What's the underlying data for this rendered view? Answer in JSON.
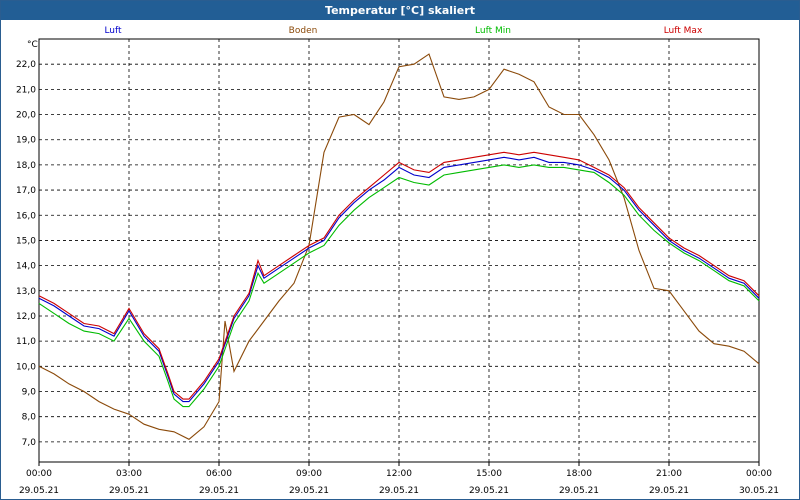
{
  "window": {
    "title": "Temperatur [°C] skaliert"
  },
  "chart_data": {
    "type": "line",
    "title": "Temperatur [°C] skaliert",
    "ylabel": "°C",
    "xlabel": "",
    "ylim": [
      6.2,
      23.0
    ],
    "xlim": [
      0,
      24
    ],
    "grid": true,
    "legend_position": "top",
    "yticks": [
      "7,0",
      "8,0",
      "9,0",
      "10,0",
      "11,0",
      "12,0",
      "13,0",
      "14,0",
      "15,0",
      "16,0",
      "17,0",
      "18,0",
      "19,0",
      "20,0",
      "21,0",
      "22,0"
    ],
    "xticks": [
      {
        "time": "00:00",
        "date": "29.05.21"
      },
      {
        "time": "03:00",
        "date": "29.05.21"
      },
      {
        "time": "06:00",
        "date": "29.05.21"
      },
      {
        "time": "09:00",
        "date": "29.05.21"
      },
      {
        "time": "12:00",
        "date": "29.05.21"
      },
      {
        "time": "15:00",
        "date": "29.05.21"
      },
      {
        "time": "18:00",
        "date": "29.05.21"
      },
      {
        "time": "21:00",
        "date": "29.05.21"
      },
      {
        "time": "00:00",
        "date": "30.05.21"
      }
    ],
    "series": [
      {
        "name": "Luft",
        "color": "#0000cc",
        "x": [
          0,
          0.5,
          1,
          1.5,
          2,
          2.5,
          3,
          3.5,
          4,
          4.3,
          4.5,
          4.8,
          5,
          5.5,
          6,
          6.5,
          7,
          7.3,
          7.5,
          8,
          8.5,
          9,
          9.5,
          10,
          10.5,
          11,
          11.5,
          12,
          12.5,
          13,
          13.5,
          14,
          14.5,
          15,
          15.5,
          16,
          16.5,
          17,
          17.5,
          18,
          18.5,
          19,
          19.5,
          20,
          20.5,
          21,
          21.5,
          22,
          22.5,
          23,
          23.5,
          24
        ],
        "y": [
          12.7,
          12.4,
          12.0,
          11.6,
          11.5,
          11.2,
          12.2,
          11.2,
          10.6,
          9.6,
          8.9,
          8.6,
          8.6,
          9.3,
          10.2,
          11.9,
          12.8,
          14.0,
          13.5,
          13.9,
          14.3,
          14.7,
          15.0,
          15.9,
          16.5,
          17.0,
          17.4,
          17.9,
          17.6,
          17.5,
          17.9,
          18.0,
          18.1,
          18.2,
          18.3,
          18.2,
          18.3,
          18.1,
          18.1,
          18.0,
          17.8,
          17.5,
          17.0,
          16.2,
          15.6,
          15.0,
          14.6,
          14.3,
          13.9,
          13.5,
          13.3,
          12.7
        ]
      },
      {
        "name": "Boden",
        "color": "#8b4a0a",
        "x": [
          0,
          0.5,
          1,
          1.5,
          2,
          2.5,
          3,
          3.5,
          4,
          4.5,
          5,
          5.5,
          6,
          6.2,
          6.5,
          7,
          7.5,
          8,
          8.5,
          9,
          9.5,
          10,
          10.5,
          11,
          11.5,
          12,
          12.5,
          13,
          13.5,
          14,
          14.5,
          15,
          15.5,
          16,
          16.5,
          17,
          17.5,
          18,
          18.5,
          19,
          19.5,
          20,
          20.5,
          21,
          21.5,
          22,
          22.5,
          23,
          23.5,
          24
        ],
        "y": [
          10.0,
          9.7,
          9.3,
          9.0,
          8.6,
          8.3,
          8.1,
          7.7,
          7.5,
          7.4,
          7.1,
          7.6,
          8.6,
          11.8,
          9.8,
          11.0,
          11.8,
          12.6,
          13.3,
          14.8,
          18.5,
          19.9,
          20.0,
          19.6,
          20.5,
          21.9,
          22.0,
          22.4,
          20.7,
          20.6,
          20.7,
          21.0,
          21.8,
          21.6,
          21.3,
          20.3,
          20.0,
          20.0,
          19.2,
          18.2,
          16.7,
          14.6,
          13.1,
          13.0,
          12.2,
          11.4,
          10.9,
          10.8,
          10.6,
          10.1
        ]
      },
      {
        "name": "Luft Min",
        "color": "#00bb00",
        "x": [
          0,
          0.5,
          1,
          1.5,
          2,
          2.5,
          3,
          3.5,
          4,
          4.3,
          4.5,
          4.8,
          5,
          5.5,
          6,
          6.5,
          7,
          7.3,
          7.5,
          8,
          8.5,
          9,
          9.5,
          10,
          10.5,
          11,
          11.5,
          12,
          12.5,
          13,
          13.5,
          14,
          14.5,
          15,
          15.5,
          16,
          16.5,
          17,
          17.5,
          18,
          18.5,
          19,
          19.5,
          20,
          20.5,
          21,
          21.5,
          22,
          22.5,
          23,
          23.5,
          24
        ],
        "y": [
          12.5,
          12.1,
          11.7,
          11.4,
          11.3,
          11.0,
          11.9,
          11.0,
          10.4,
          9.4,
          8.7,
          8.4,
          8.4,
          9.1,
          10.0,
          11.7,
          12.6,
          13.7,
          13.3,
          13.7,
          14.1,
          14.5,
          14.8,
          15.6,
          16.2,
          16.7,
          17.1,
          17.5,
          17.3,
          17.2,
          17.6,
          17.7,
          17.8,
          17.9,
          18.0,
          17.9,
          18.0,
          17.9,
          17.9,
          17.8,
          17.7,
          17.3,
          16.8,
          16.0,
          15.4,
          14.9,
          14.5,
          14.2,
          13.8,
          13.4,
          13.2,
          12.6
        ]
      },
      {
        "name": "Luft Max",
        "color": "#cc0000",
        "x": [
          0,
          0.5,
          1,
          1.5,
          2,
          2.5,
          3,
          3.5,
          4,
          4.3,
          4.5,
          4.8,
          5,
          5.5,
          6,
          6.5,
          7,
          7.3,
          7.5,
          8,
          8.5,
          9,
          9.5,
          10,
          10.5,
          11,
          11.5,
          12,
          12.5,
          13,
          13.5,
          14,
          14.5,
          15,
          15.5,
          16,
          16.5,
          17,
          17.5,
          18,
          18.5,
          19,
          19.5,
          20,
          20.5,
          21,
          21.5,
          22,
          22.5,
          23,
          23.5,
          24
        ],
        "y": [
          12.8,
          12.5,
          12.1,
          11.7,
          11.6,
          11.3,
          12.3,
          11.3,
          10.7,
          9.7,
          9.0,
          8.7,
          8.7,
          9.4,
          10.3,
          12.0,
          12.9,
          14.2,
          13.6,
          14.0,
          14.4,
          14.8,
          15.1,
          16.0,
          16.6,
          17.1,
          17.6,
          18.1,
          17.8,
          17.7,
          18.1,
          18.2,
          18.3,
          18.4,
          18.5,
          18.4,
          18.5,
          18.4,
          18.3,
          18.2,
          17.9,
          17.6,
          17.1,
          16.3,
          15.7,
          15.1,
          14.7,
          14.4,
          14.0,
          13.6,
          13.4,
          12.8
        ]
      }
    ]
  }
}
